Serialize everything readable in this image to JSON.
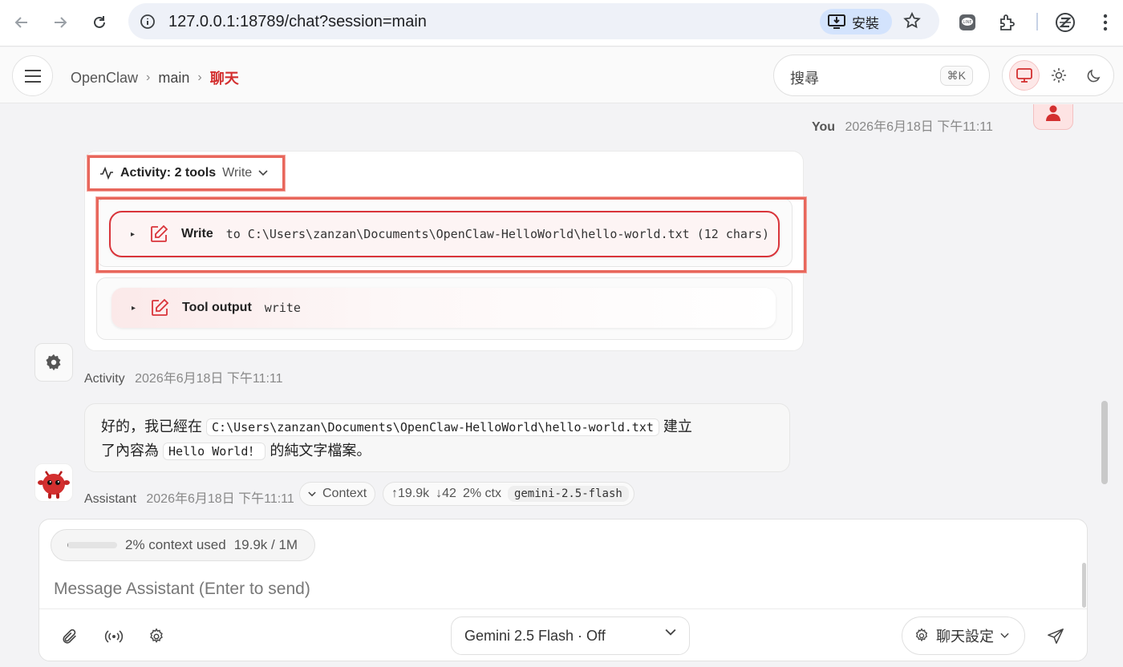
{
  "browser": {
    "url": "127.0.0.1:18789/chat?session=main",
    "install_label": "安裝"
  },
  "header": {
    "breadcrumb": [
      "OpenClaw",
      "main",
      "聊天"
    ],
    "search_placeholder": "搜尋",
    "search_shortcut": "⌘K"
  },
  "messages": {
    "user": {
      "name": "You",
      "time": "2026年6月18日 下午11:11"
    },
    "activity": {
      "title": "Activity: 2 tools",
      "summary": "Write",
      "tools": [
        {
          "name": "Write",
          "detail": "to C:\\Users\\zanzan\\Documents\\OpenClaw-HelloWorld\\hello-world.txt (12 chars)"
        },
        {
          "name": "Tool output",
          "detail": "write"
        }
      ],
      "sender": "Activity",
      "time": "2026年6月18日 下午11:11"
    },
    "assistant": {
      "text_1": "好的，我已經在",
      "path": "C:\\Users\\zanzan\\Documents\\OpenClaw-HelloWorld\\hello-world.txt",
      "text_2": "建立",
      "text_3": "了內容為",
      "content": "Hello World！",
      "text_4": "的純文字檔案。",
      "sender": "Assistant",
      "time": "2026年6月18日 下午11:11",
      "context_label": "Context",
      "tokens_in": "↑19.9k",
      "tokens_out": "↓42",
      "ctx_pct": "2% ctx",
      "model": "gemini-2.5-flash"
    }
  },
  "composer": {
    "context_used": "2% context used",
    "context_tokens": "19.9k / 1M",
    "context_fraction": 0.02,
    "placeholder": "Message Assistant (Enter to send)",
    "model_select": "Gemini 2.5 Flash · Off",
    "settings_label": "聊天設定"
  },
  "colors": {
    "accent": "#d32f2f",
    "highlight_box": "#e8675c"
  }
}
